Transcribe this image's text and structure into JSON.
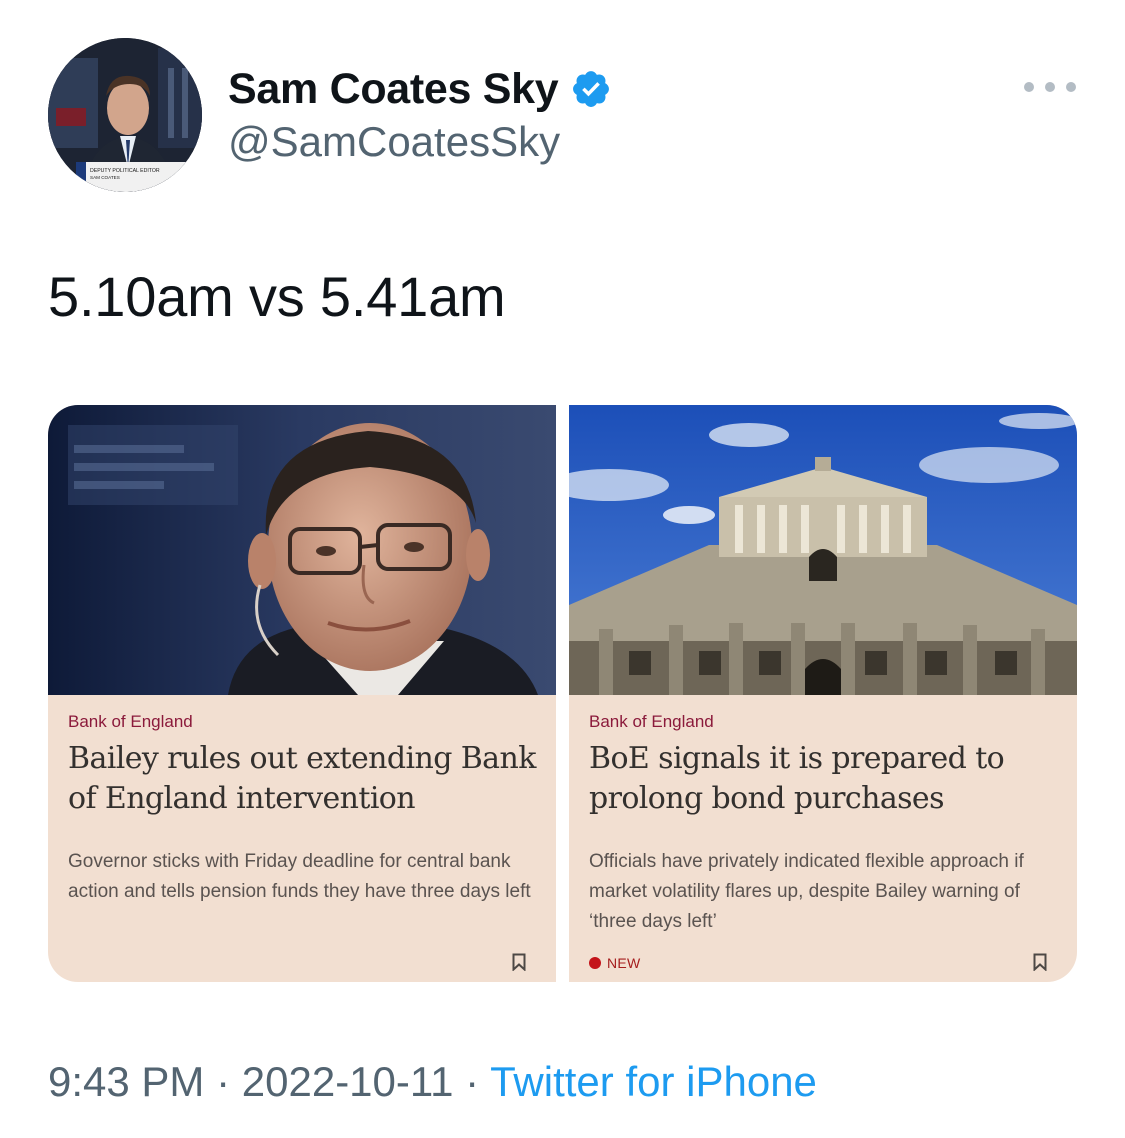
{
  "author": {
    "display_name": "Sam Coates Sky",
    "handle": "@SamCoatesSky",
    "avatar_caption_line1": "DEPUTY POLITICAL EDITOR",
    "avatar_caption_line2": "SAM COATES"
  },
  "tweet": {
    "text": "5.10am vs 5.41am",
    "time": "9:43 PM",
    "date": "2022-10-11",
    "separator": "·",
    "source": "Twitter for iPhone"
  },
  "cards": [
    {
      "section": "Bank of England",
      "headline": "Bailey rules out extending Bank of England intervention",
      "standfirst": "Governor sticks with Friday deadline for central bank action and tells pension funds they have three days left"
    },
    {
      "section": "Bank of England",
      "headline": "BoE signals it is prepared to prolong bond purchases",
      "standfirst": "Officials have privately indicated flexible approach if market volatility flares up, despite Bailey warning of ‘three days left’",
      "badge": "NEW"
    }
  ],
  "colors": {
    "verified": "#1d9bf0",
    "link": "#1d9bf0",
    "card_background": "#f2dfd1",
    "section_label": "#8b1a3b",
    "new_badge": "#c4141a"
  },
  "icons": [
    "verified-badge-icon",
    "more-options-icon",
    "bookmark-icon"
  ]
}
